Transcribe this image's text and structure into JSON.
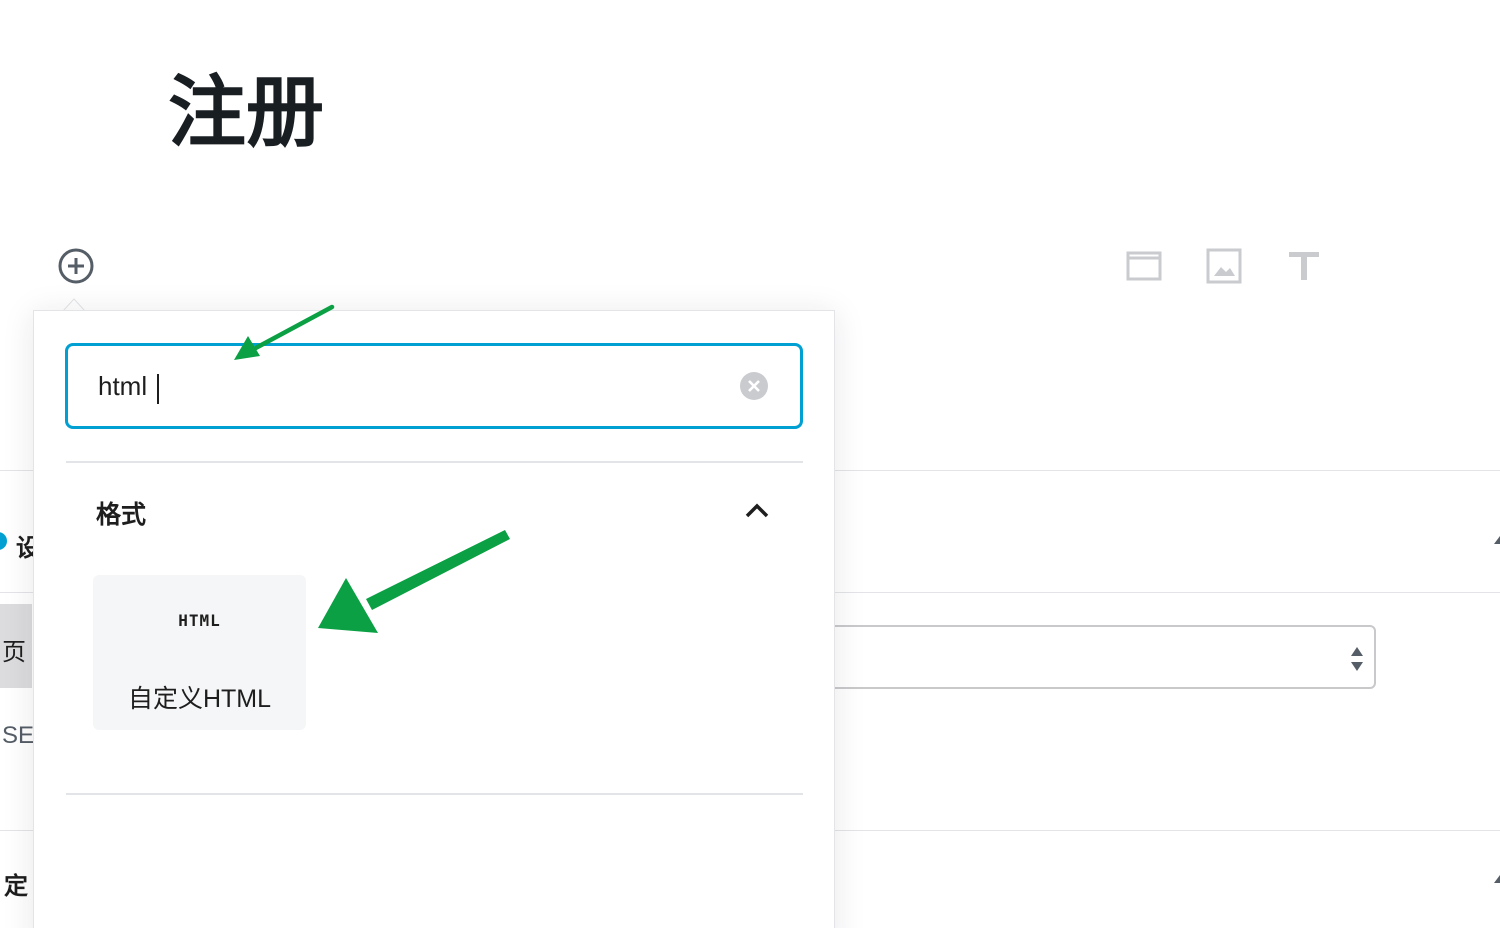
{
  "post": {
    "title": "注册"
  },
  "toolbar": {
    "inserter_icon": "plus-circle-icon",
    "quick_blocks": [
      "block-icon",
      "image-icon",
      "text-icon"
    ]
  },
  "background": {
    "settings_label": "设",
    "page_label": "页",
    "seo_label": "SE",
    "custom_label": "定"
  },
  "inserter": {
    "search_value": "html",
    "search_placeholder": "",
    "section": {
      "title": "格式",
      "expanded": true
    },
    "results": [
      {
        "icon_text": "HTML",
        "label": "自定义HTML"
      }
    ]
  },
  "colors": {
    "focus_border": "#00a0d2",
    "annotation_arrow": "#0aa043",
    "block_item_bg": "#f5f6f7"
  }
}
